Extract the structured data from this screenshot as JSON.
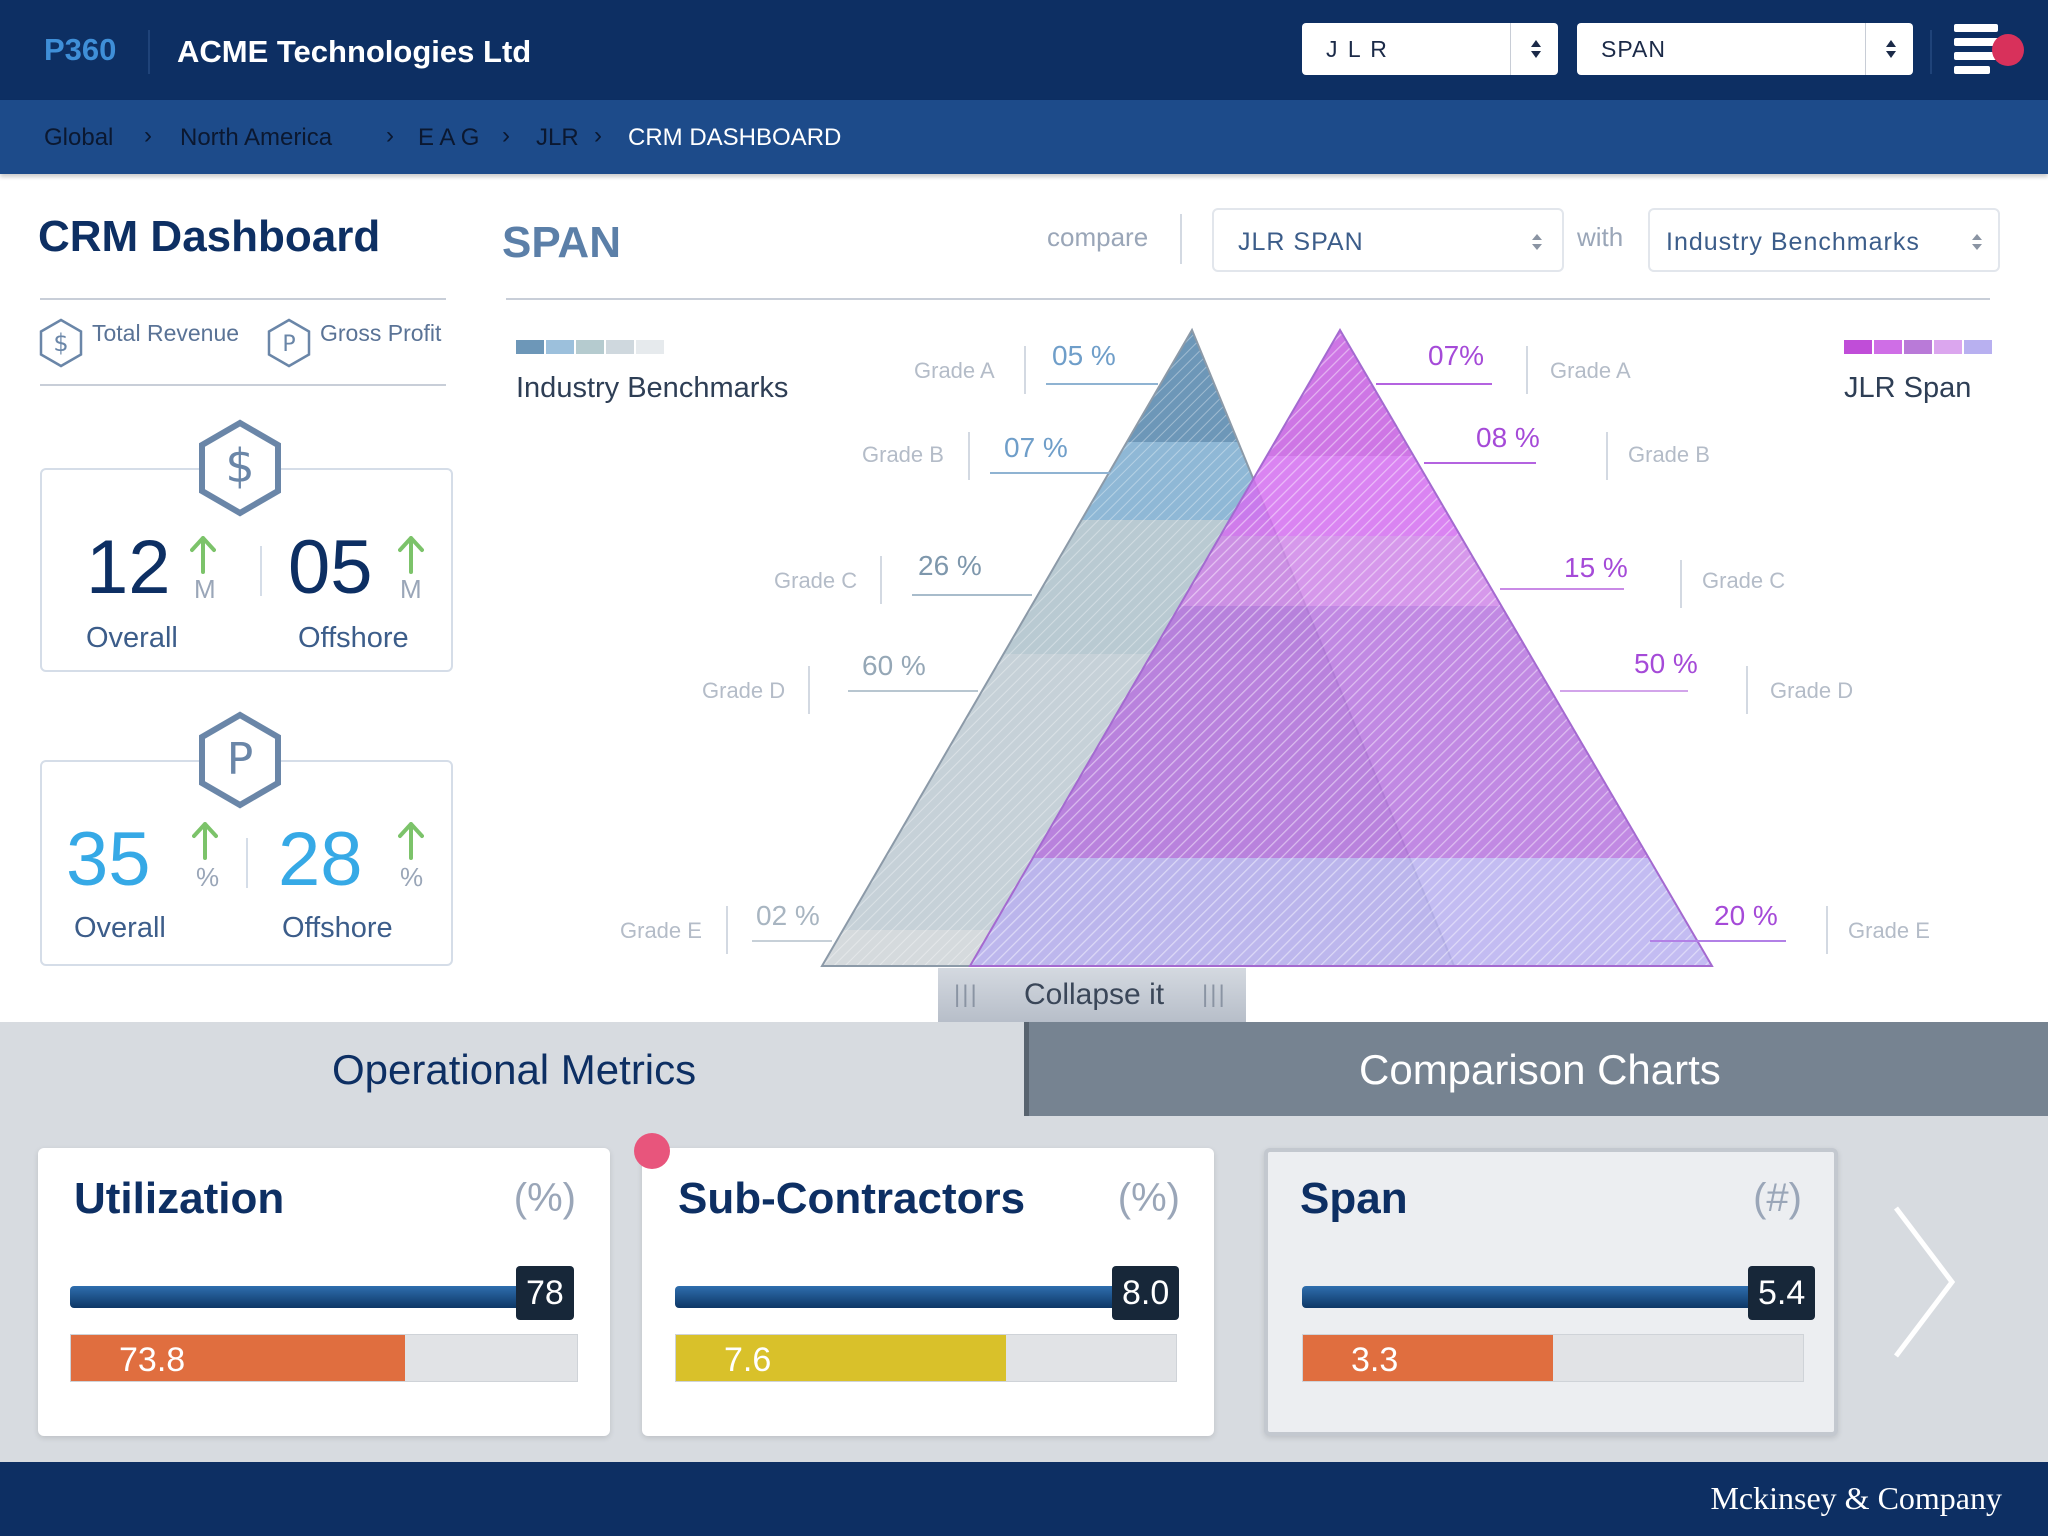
{
  "header": {
    "brand": "P360",
    "company": "ACME Technologies Ltd",
    "client_select": "J L R",
    "metric_select": "SPAN",
    "menu_icon": "hamburger-menu-icon"
  },
  "breadcrumb": [
    "Global",
    "North America",
    "E A G",
    "JLR",
    "CRM DASHBOARD"
  ],
  "sidebar": {
    "title": "CRM Dashboard",
    "legend": [
      {
        "icon": "dollar-hexagon-icon",
        "label": "Total Revenue"
      },
      {
        "icon": "p-hexagon-icon",
        "label": "Gross Profit"
      }
    ],
    "revenue": {
      "overall": {
        "value": "12",
        "unit": "M",
        "label": "Overall",
        "trend": "up"
      },
      "offshore": {
        "value": "05",
        "unit": "M",
        "label": "Offshore",
        "trend": "up"
      }
    },
    "profit": {
      "overall": {
        "value": "35",
        "unit": "%",
        "label": "Overall",
        "trend": "up"
      },
      "offshore": {
        "value": "28",
        "unit": "%",
        "label": "Offshore",
        "trend": "up"
      }
    }
  },
  "span_panel": {
    "title": "SPAN",
    "compare_label": "compare",
    "compare_select": "JLR SPAN",
    "with_label": "with",
    "with_select": "Industry Benchmarks",
    "left_legend": "Industry Benchmarks",
    "right_legend": "JLR Span",
    "collapse_label": "Collapse it",
    "grip": "|||"
  },
  "pyramid": {
    "grades": [
      "Grade A",
      "Grade B",
      "Grade C",
      "Grade D",
      "Grade E"
    ],
    "industry_labels": [
      "05 %",
      "07 %",
      "26 %",
      "60 %",
      "02 %"
    ],
    "industry_values": [
      5,
      7,
      26,
      60,
      2
    ],
    "jlr_labels": [
      "07%",
      "08 %",
      "15 %",
      "50 %",
      "20 %"
    ],
    "jlr_values": [
      7,
      8,
      15,
      50,
      20
    ],
    "industry_colors": [
      "#6d97b8",
      "#8fb8d6",
      "#b9cad2",
      "#c6d1d8",
      "#d5dadd"
    ],
    "jlr_colors": [
      "#c65ee0",
      "#d46ef0",
      "#cf86e8",
      "#b674de",
      "#b8b0f0"
    ]
  },
  "tabs": {
    "operational": "Operational Metrics",
    "comparison": "Comparison Charts"
  },
  "metrics": [
    {
      "title": "Utilization",
      "unit": "(%)",
      "benchmark": "78",
      "value": "73.8",
      "fill_pct": 66,
      "color": "#e06e3f"
    },
    {
      "title": "Sub-Contractors",
      "unit": "(%)",
      "benchmark": "8.0",
      "value": "7.6",
      "fill_pct": 66,
      "color": "#d9c12a"
    },
    {
      "title": "Span",
      "unit": "(#)",
      "benchmark": "5.4",
      "value": "3.3",
      "fill_pct": 50,
      "color": "#e06e3f"
    }
  ],
  "footer": "Mckinsey & Company"
}
